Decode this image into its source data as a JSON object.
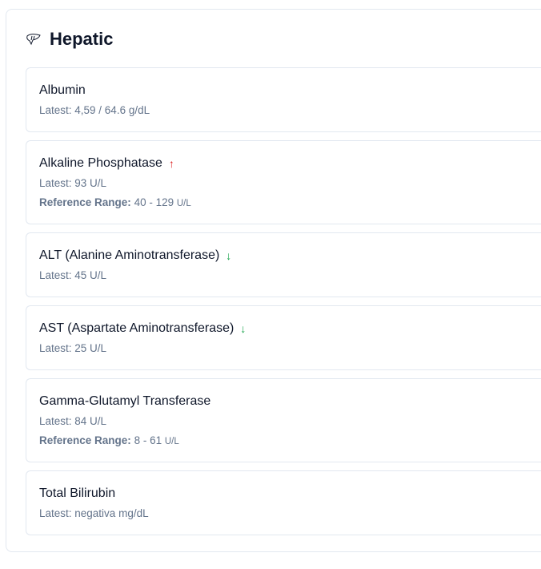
{
  "section": {
    "title": "Hepatic",
    "icon": "liver-icon"
  },
  "colors": {
    "up": "#dc2626",
    "down": "#16a34a"
  },
  "tests": [
    {
      "name": "Albumin",
      "latest": "Latest: 4,59 / 64.6 g/dL",
      "trend": null
    },
    {
      "name": "Alkaline Phosphatase",
      "latest": "Latest: 93 U/L",
      "trend": "↑",
      "ref_label": "Reference Range:",
      "ref_value": "40 - 129",
      "ref_unit": "U/L"
    },
    {
      "name": "ALT (Alanine Aminotransferase)",
      "latest": "Latest: 45 U/L",
      "trend": "↓"
    },
    {
      "name": "AST (Aspartate Aminotransferase)",
      "latest": "Latest: 25 U/L",
      "trend": "↓"
    },
    {
      "name": "Gamma-Glutamyl Transferase",
      "latest": "Latest: 84 U/L",
      "trend": null,
      "ref_label": "Reference Range:",
      "ref_value": "8 - 61",
      "ref_unit": "U/L"
    },
    {
      "name": "Total Bilirubin",
      "latest": "Latest: negativa mg/dL",
      "trend": null
    }
  ]
}
